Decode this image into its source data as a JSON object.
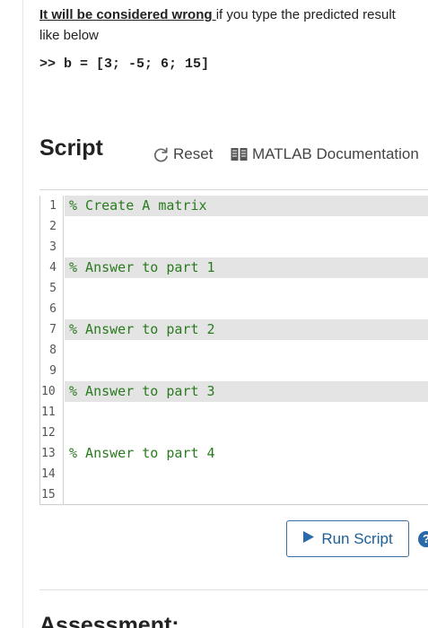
{
  "instructions": {
    "emphasis": "It will be considered wrong ",
    "rest": "if you type the predicted result like below",
    "example_code": ">> b = [3; -5; 6; 15]"
  },
  "script": {
    "title": "Script",
    "reset_label": "Reset",
    "docs_label": "MATLAB Documentation",
    "reset_icon": "reset-icon",
    "docs_icon": "book-icon"
  },
  "editor": {
    "lines": [
      {
        "n": "1",
        "code": "% Create A matrix",
        "highlight": true
      },
      {
        "n": "2",
        "code": "",
        "highlight": false
      },
      {
        "n": "3",
        "code": "",
        "highlight": false
      },
      {
        "n": "4",
        "code": "% Answer to part 1",
        "highlight": true
      },
      {
        "n": "5",
        "code": "",
        "highlight": false
      },
      {
        "n": "6",
        "code": "",
        "highlight": false
      },
      {
        "n": "7",
        "code": "% Answer to part 2",
        "highlight": true
      },
      {
        "n": "8",
        "code": "",
        "highlight": false
      },
      {
        "n": "9",
        "code": "",
        "highlight": false
      },
      {
        "n": "10",
        "code": "% Answer to part 3",
        "highlight": true
      },
      {
        "n": "11",
        "code": "",
        "highlight": false
      },
      {
        "n": "12",
        "code": "",
        "highlight": false
      },
      {
        "n": "13",
        "code": "% Answer to part 4",
        "highlight": false
      },
      {
        "n": "14",
        "code": "",
        "highlight": false
      },
      {
        "n": "15",
        "code": "",
        "highlight": false
      }
    ],
    "comment_color": "#2a7b1f",
    "highlight_color": "#e4e4e4"
  },
  "actions": {
    "run_label": "Run Script",
    "run_icon": "play-icon",
    "help_icon": "help-icon",
    "help_glyph": "?"
  },
  "next_section": {
    "heading": "Assessment:"
  }
}
